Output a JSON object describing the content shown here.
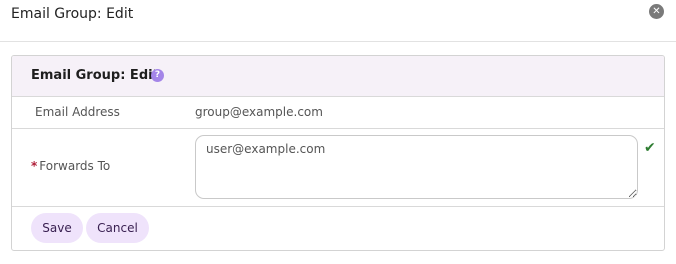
{
  "dialog": {
    "title": "Email Group: Edit",
    "close_icon": "close-icon"
  },
  "panel": {
    "title": "Email Group: Edit",
    "help_icon": "help-icon"
  },
  "form": {
    "email_label": "Email Address",
    "email_value": "group@example.com",
    "forwards_required_marker": "*",
    "forwards_label": "Forwards To",
    "forwards_value": "user@example.com",
    "valid_icon": "check-icon"
  },
  "actions": {
    "save_label": "Save",
    "cancel_label": "Cancel"
  },
  "colors": {
    "panel_header_bg": "#f6f1f8",
    "button_bg": "#efe3fb",
    "help_icon": "#a485e8",
    "required": "#b0203a",
    "valid": "#2e7d32"
  }
}
